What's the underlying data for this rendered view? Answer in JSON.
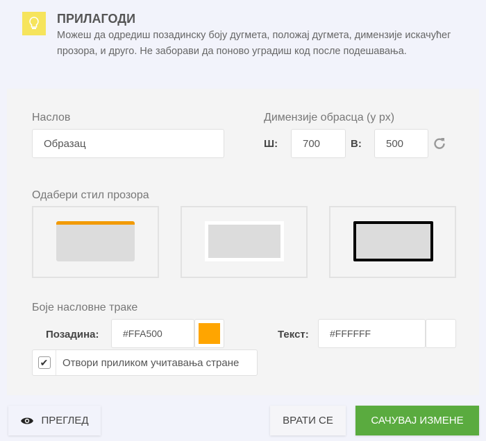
{
  "header": {
    "title": "ПРИЛАГОДИ",
    "description": "Можеш да одредиш позадинску боју дугмета, положај дугмета, димензије искачућег прозора, и друго. Не заборави да поново уградиш код после подешавања.",
    "icon": "lightbulb-icon"
  },
  "form": {
    "title_label": "Наслов",
    "title_value": "Образац",
    "dimensions_label": "Димензије обрасца (у px)",
    "width_label": "Ш:",
    "width_value": "700",
    "height_label": "В:",
    "height_value": "500",
    "style_label": "Одабери стил прозора",
    "colors_label": "Боје насловне траке",
    "bg_label": "Позадина:",
    "bg_value": "#FFA500",
    "text_label": "Текст:",
    "text_value": "#FFFFFF",
    "open_on_load_label": "Отвори приликом учитавања стране",
    "open_on_load_checked": true
  },
  "colors": {
    "bg": "#FFA500",
    "text": "#FFFFFF",
    "save": "#5aab3f"
  },
  "footer": {
    "preview": "ПРЕГЛЕД",
    "back": "ВРАТИ СЕ",
    "save": "САЧУВАЈ ИЗМЕНЕ"
  }
}
